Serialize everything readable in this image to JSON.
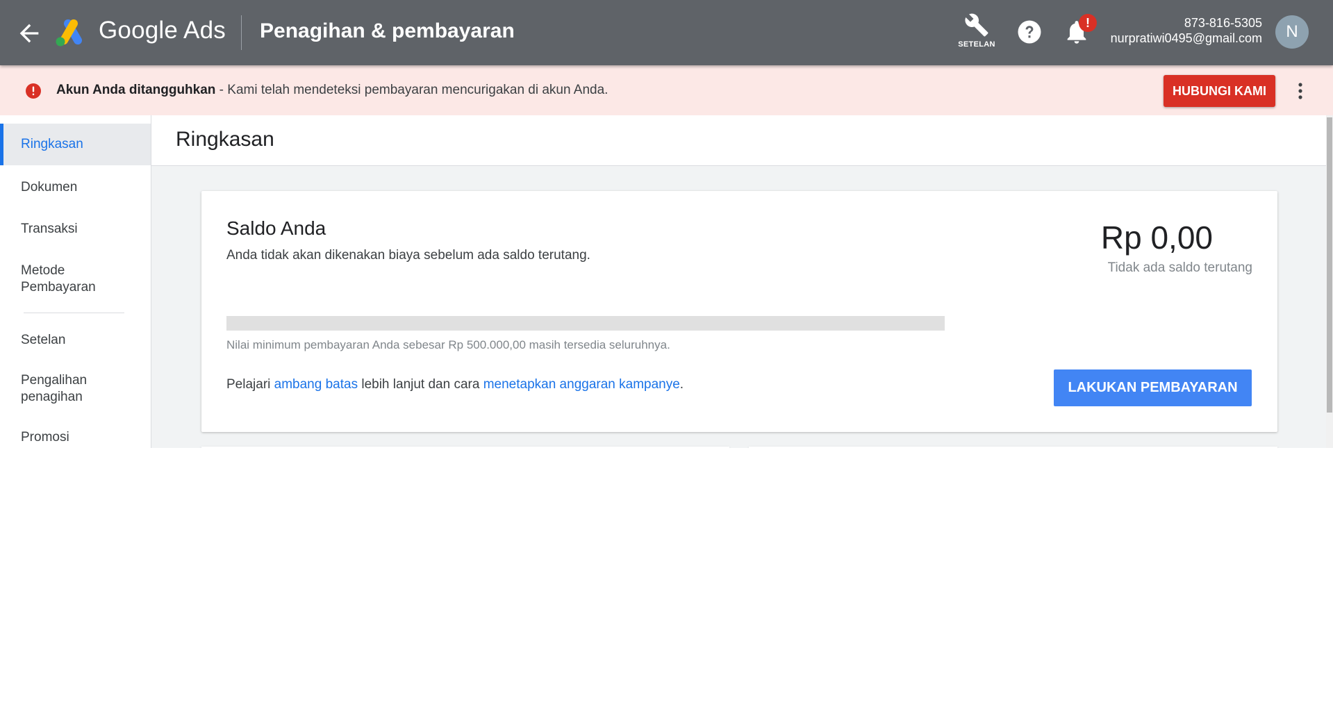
{
  "header": {
    "brand": "Google Ads",
    "page_title": "Penagihan & pembayaran",
    "tools_label": "SETELAN",
    "notification_badge": "!",
    "customer_id": "873-816-5305",
    "email": "nurpratiwi0495@gmail.com",
    "avatar_initial": "N",
    "icons": [
      "arrow-back-icon",
      "google-ads-logo",
      "wrench-icon",
      "help-icon",
      "bell-icon"
    ]
  },
  "banner": {
    "bold": "Akun Anda ditangguhkan",
    "message": " - Kami telah mendeteksi pembayaran mencurigakan di akun Anda.",
    "button": "HUBUNGI KAMI",
    "icon": "error-icon"
  },
  "sidebar": {
    "items": [
      {
        "label": "Ringkasan",
        "active": true
      },
      {
        "label": "Dokumen"
      },
      {
        "label": "Transaksi"
      },
      {
        "label": "Metode Pembayaran"
      },
      {
        "label": "Setelan"
      },
      {
        "label": "Pengalihan penagihan"
      },
      {
        "label": "Promosi"
      }
    ]
  },
  "main": {
    "title": "Ringkasan",
    "balance_card": {
      "title": "Saldo Anda",
      "subtitle": "Anda tidak akan dikenakan biaya sebelum ada saldo terutang.",
      "amount": "Rp 0,00",
      "amount_note": "Tidak ada saldo terutang",
      "progress_fraction": 0,
      "min_note": "Nilai minimum pembayaran Anda sebesar Rp 500.000,00 masih tersedia seluruhnya.",
      "learn_prefix": "Pelajari ",
      "learn_link1": "ambang batas",
      "learn_middle": " lebih lanjut dan cara ",
      "learn_link2": "menetapkan anggaran kampanye",
      "learn_suffix": ".",
      "pay_button": "LAKUKAN PEMBAYARAN"
    }
  },
  "colors": {
    "header_bg": "#5f6368",
    "banner_bg": "#fce8e6",
    "alert_red": "#d93025",
    "link_blue": "#1a73e8",
    "primary_button": "#4285f4"
  }
}
